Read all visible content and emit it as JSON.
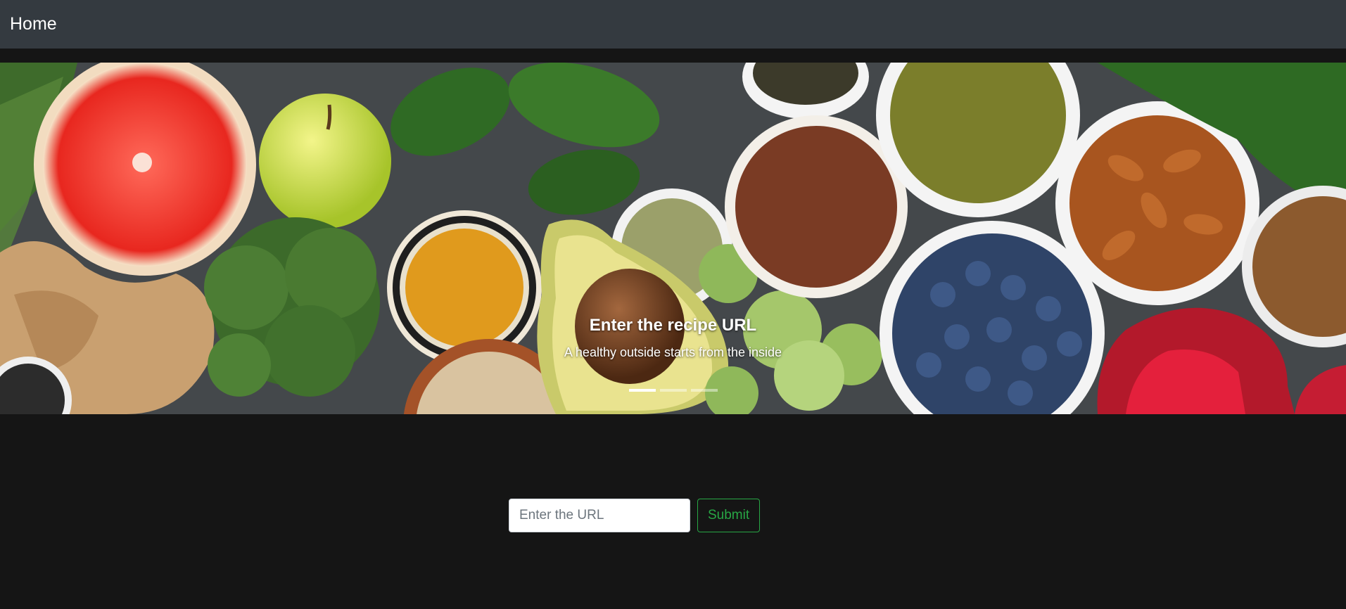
{
  "navbar": {
    "brand": "Home"
  },
  "carousel": {
    "slide_image": "healthy-food-bowls-image",
    "caption_title": "Enter the recipe URL",
    "caption_text": "A healthy outside starts from the inside",
    "indicators": 3,
    "active_indicator": 1
  },
  "form": {
    "url_placeholder": "Enter the URL",
    "url_value": "",
    "submit_label": "Submit"
  },
  "colors": {
    "page_background": "#151515",
    "navbar_background": "#343a40",
    "submit_accent": "#28a745"
  }
}
